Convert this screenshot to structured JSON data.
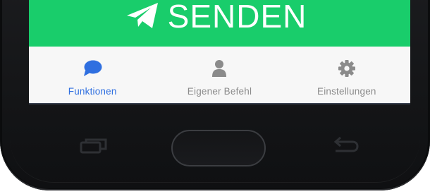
{
  "send_button": {
    "label": "SENDEN",
    "icon": "paper-plane-icon",
    "color": "#19cd6b"
  },
  "tabs": [
    {
      "label": "Funktionen",
      "icon": "chat-bubble-icon",
      "active": true,
      "color": "#2f6fe0"
    },
    {
      "label": "Eigener Befehl",
      "icon": "user-icon",
      "active": false,
      "color": "#8b8b8b"
    },
    {
      "label": "Einstellungen",
      "icon": "gear-icon",
      "active": false,
      "color": "#8b8b8b"
    }
  ],
  "hardware_keys": {
    "recent": "recent-apps-icon",
    "home": "home-button",
    "back": "back-arrow-icon"
  }
}
